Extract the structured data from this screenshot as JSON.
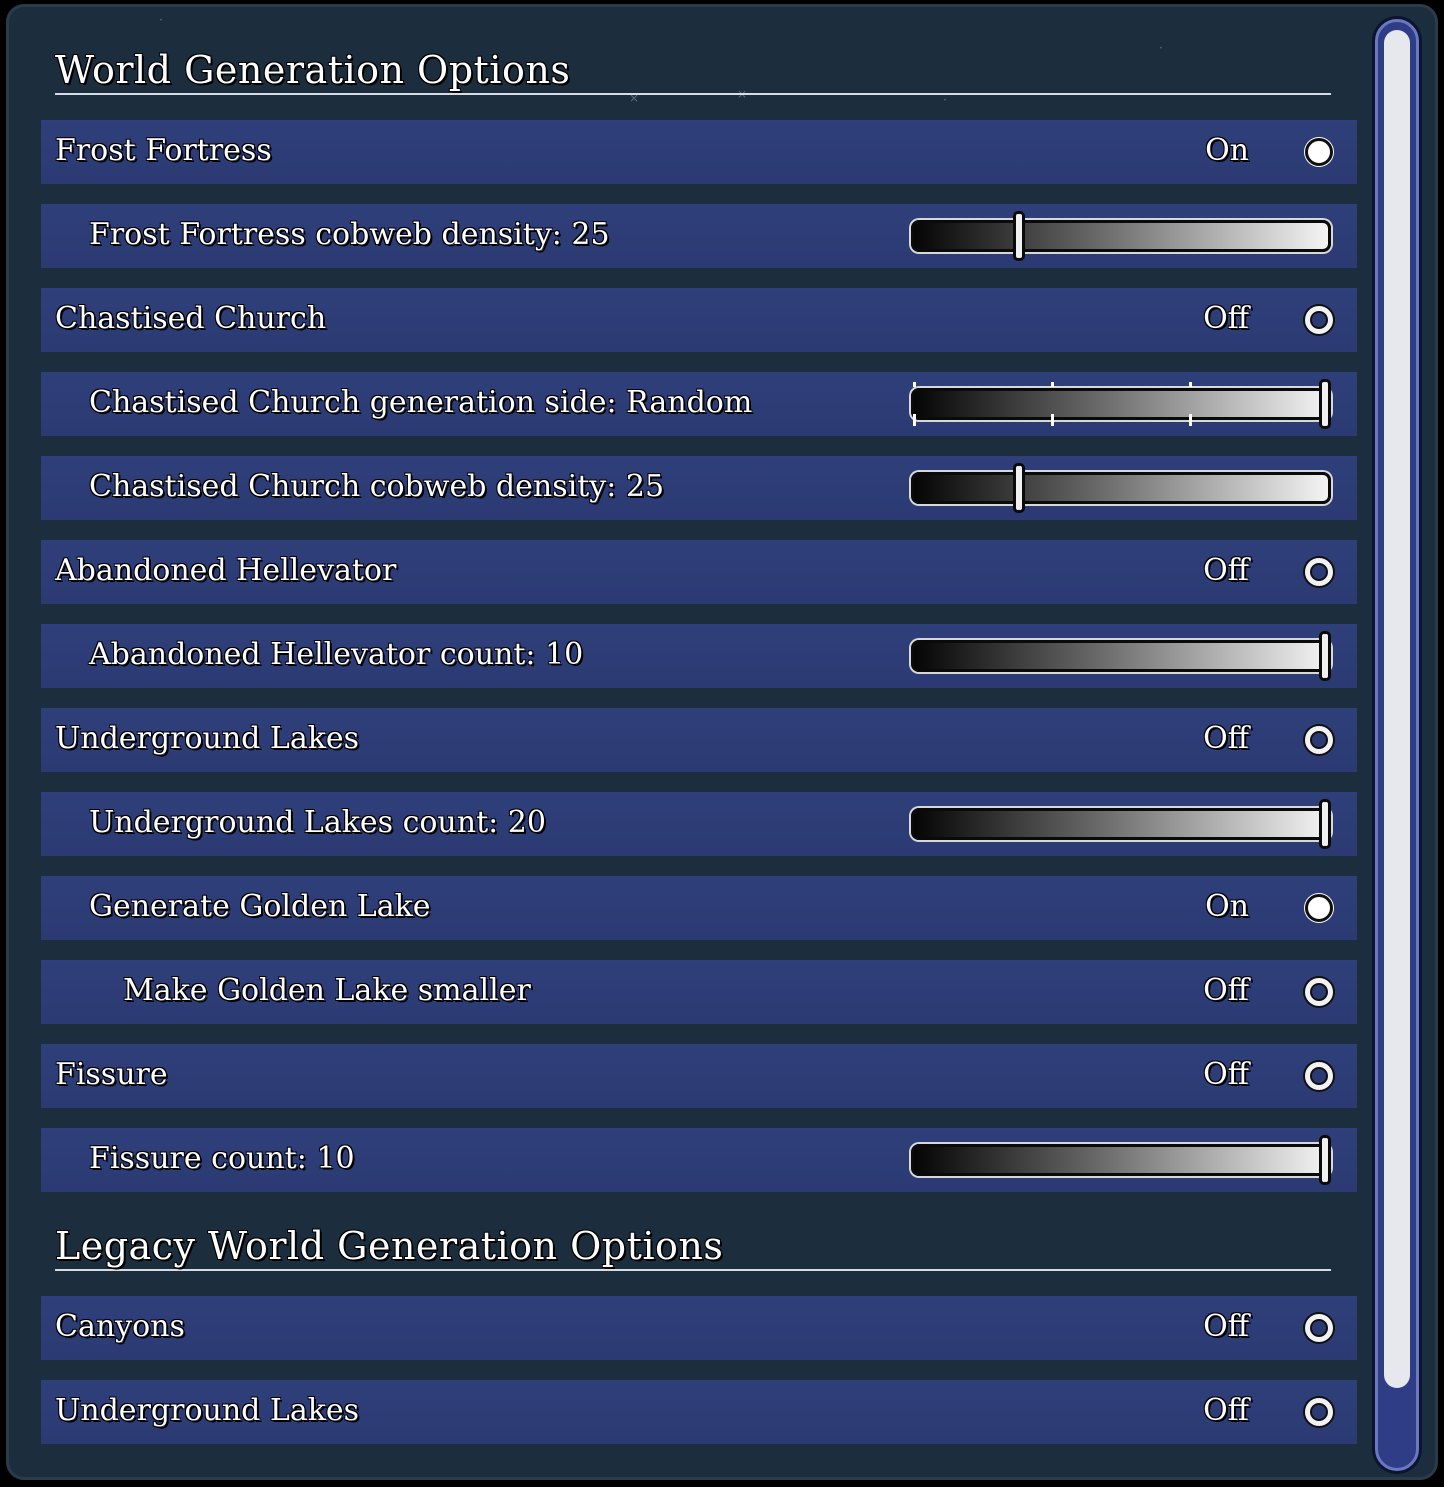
{
  "sections": {
    "world": {
      "title": "World Generation Options"
    },
    "legacy": {
      "title": "Legacy World Generation Options"
    }
  },
  "rows": [
    {
      "kind": "toggle",
      "label": "Frost Fortress",
      "state": "On",
      "indent": 0
    },
    {
      "kind": "slider",
      "label": "Frost Fortress cobweb density: 25",
      "value": 0.25,
      "indent": 1
    },
    {
      "kind": "toggle",
      "label": "Chastised Church",
      "state": "Off",
      "indent": 0
    },
    {
      "kind": "slider",
      "label": "Chastised Church generation side: Random",
      "value": 1.0,
      "indent": 1,
      "ticks": true
    },
    {
      "kind": "slider",
      "label": "Chastised Church cobweb density: 25",
      "value": 0.25,
      "indent": 1
    },
    {
      "kind": "toggle",
      "label": "Abandoned Hellevator",
      "state": "Off",
      "indent": 0
    },
    {
      "kind": "slider",
      "label": "Abandoned Hellevator count: 10",
      "value": 1.0,
      "indent": 1
    },
    {
      "kind": "toggle",
      "label": "Underground Lakes",
      "state": "Off",
      "indent": 0
    },
    {
      "kind": "slider",
      "label": "Underground Lakes count: 20",
      "value": 1.0,
      "indent": 1
    },
    {
      "kind": "toggle",
      "label": "Generate Golden Lake",
      "state": "On",
      "indent": 1
    },
    {
      "kind": "toggle",
      "label": "Make Golden Lake smaller",
      "state": "Off",
      "indent": 2
    },
    {
      "kind": "toggle",
      "label": "Fissure",
      "state": "Off",
      "indent": 0
    },
    {
      "kind": "slider",
      "label": "Fissure count: 10",
      "value": 1.0,
      "indent": 1
    }
  ],
  "legacy_rows": [
    {
      "kind": "toggle",
      "label": "Canyons",
      "state": "Off",
      "indent": 0
    },
    {
      "kind": "toggle",
      "label": "Underground Lakes",
      "state": "Off",
      "indent": 0
    }
  ]
}
